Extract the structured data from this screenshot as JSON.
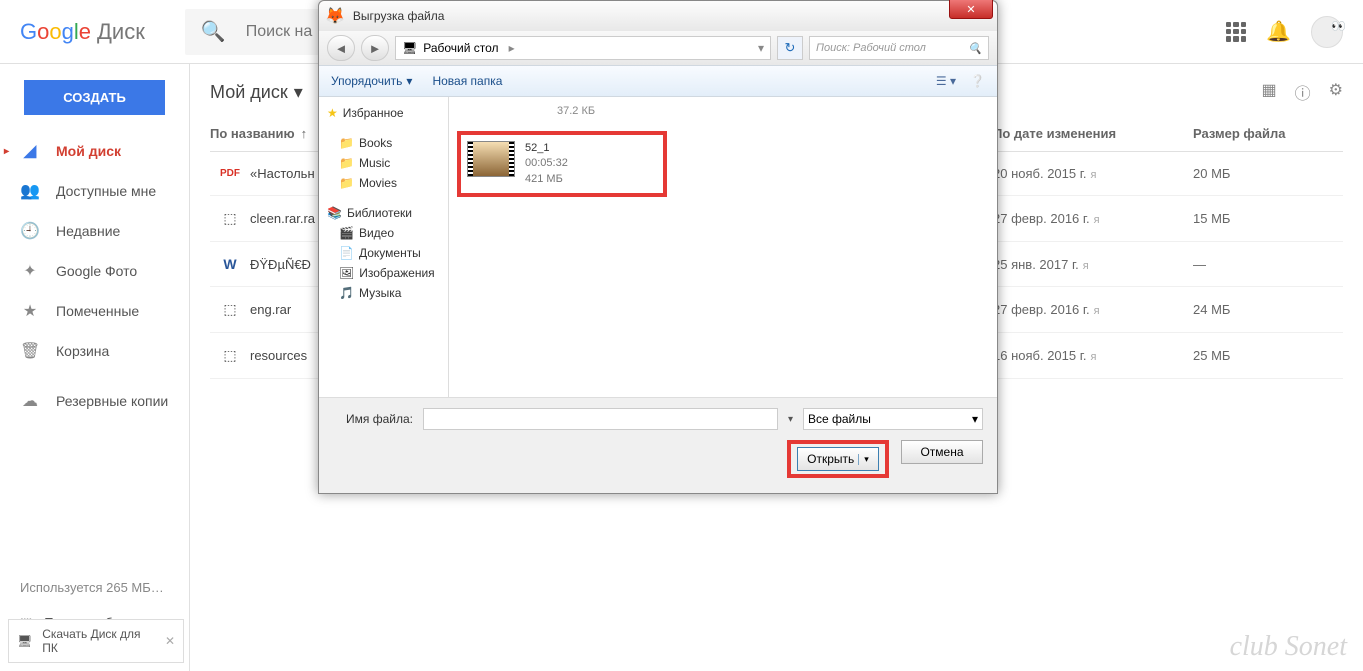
{
  "header": {
    "logo_text": "Google",
    "product": "Диск",
    "search_placeholder": "Поиск на"
  },
  "sidebar": {
    "create": "СОЗДАТЬ",
    "items": [
      {
        "icon": "▲",
        "label": "Мой диск"
      },
      {
        "icon": "👥",
        "label": "Доступные мне"
      },
      {
        "icon": "🕘",
        "label": "Недавние"
      },
      {
        "icon": "✦",
        "label": "Google Фото"
      },
      {
        "icon": "★",
        "label": "Помеченные"
      },
      {
        "icon": "🗑",
        "label": "Корзина"
      },
      {
        "icon": "☁",
        "label": "Резервные копии"
      }
    ],
    "storage": "Используется 265 МБ…",
    "get_more": "Получить больше пространства"
  },
  "content": {
    "breadcrumb": "Мой диск",
    "columns": {
      "name": "По названию",
      "date": "По дате изменения",
      "size": "Размер файла"
    },
    "rows": [
      {
        "icon": "PDF",
        "icon_color": "#d93025",
        "name": "«Настольн",
        "date": "20 нояб. 2015 г.",
        "owner": "я",
        "size": "20 МБ"
      },
      {
        "icon": "⬚",
        "icon_color": "#777",
        "name": "cleen.rar.ra",
        "date": "27 февр. 2016 г.",
        "owner": "я",
        "size": "15 МБ"
      },
      {
        "icon": "W",
        "icon_color": "#2a5699",
        "name": "ÐŸÐµÑ€Ð",
        "date": "25 янв. 2017 г.",
        "owner": "я",
        "size": "—"
      },
      {
        "icon": "⬚",
        "icon_color": "#777",
        "name": "eng.rar",
        "date": "27 февр. 2016 г.",
        "owner": "я",
        "size": "24 МБ"
      },
      {
        "icon": "⬚",
        "icon_color": "#777",
        "name": "resources",
        "date": "16 нояб. 2015 г.",
        "owner": "я",
        "size": "25 МБ"
      }
    ]
  },
  "dialog": {
    "title": "Выгрузка файла",
    "address": "Рабочий стол",
    "search_placeholder": "Поиск: Рабочий стол",
    "organize": "Упорядочить",
    "new_folder": "Новая папка",
    "tree": {
      "favorites": "Избранное",
      "books": "Books",
      "music": "Music",
      "movies": "Movies",
      "libraries": "Библиотеки",
      "video": "Видео",
      "documents": "Документы",
      "images": "Изображения",
      "music2": "Музыка"
    },
    "prev_size": "37.2 КБ",
    "file": {
      "name": "52_1",
      "duration": "00:05:32",
      "size": "421 МБ"
    },
    "filename_label": "Имя файла:",
    "filter": "Все файлы",
    "open": "Открыть",
    "cancel": "Отмена"
  },
  "download_bar": "Скачать Диск для ПК",
  "watermark": "club Sonet"
}
